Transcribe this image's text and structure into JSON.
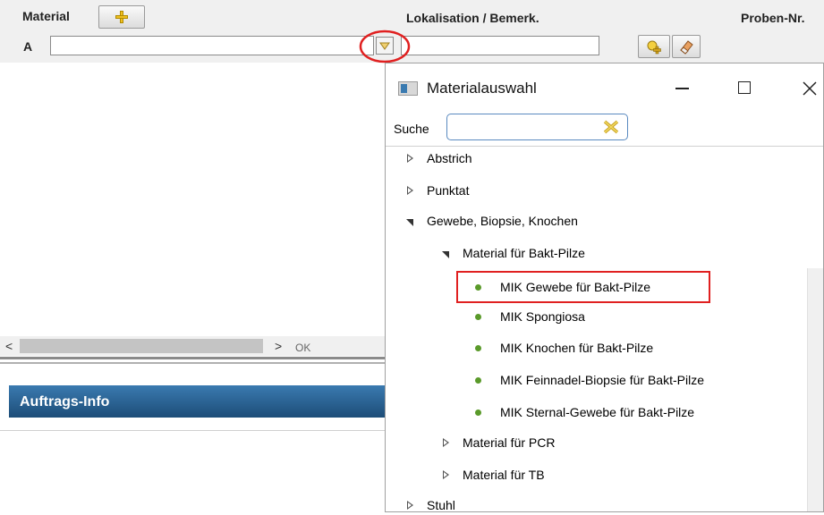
{
  "form": {
    "material_header": "Material",
    "location_header": "Lokalisation / Bemerk.",
    "sample_header": "Proben-Nr.",
    "row_label": "A",
    "material_value": "",
    "location_value": ""
  },
  "scrollbar": {
    "ok_label": "OK"
  },
  "info_section": {
    "title": "Auftrags-Info"
  },
  "dialog": {
    "title": "Materialauswahl",
    "search_label": "Suche",
    "search_value": "",
    "tree": [
      {
        "label": "Abstrich",
        "state": "collapsed"
      },
      {
        "label": "Punktat",
        "state": "collapsed"
      },
      {
        "label": "Gewebe, Biopsie, Knochen",
        "state": "expanded"
      },
      {
        "label": "Material für Bakt-Pilze",
        "state": "expanded"
      },
      {
        "label": "MIK Gewebe für Bakt-Pilze",
        "state": "leaf",
        "highlighted": true
      },
      {
        "label": "MIK Spongiosa",
        "state": "leaf"
      },
      {
        "label": "MIK Knochen für Bakt-Pilze",
        "state": "leaf"
      },
      {
        "label": "MIK Feinnadel-Biopsie für Bakt-Pilze",
        "state": "leaf"
      },
      {
        "label": "MIK Sternal-Gewebe für Bakt-Pilze",
        "state": "leaf"
      },
      {
        "label": "Material für PCR",
        "state": "collapsed"
      },
      {
        "label": "Material für TB",
        "state": "collapsed"
      },
      {
        "label": "Stuhl",
        "state": "collapsed"
      }
    ]
  },
  "colors": {
    "annotation_red": "#e02020",
    "leaf_dot": "#5a9a2a",
    "info_bar": "#2a5f8f"
  }
}
